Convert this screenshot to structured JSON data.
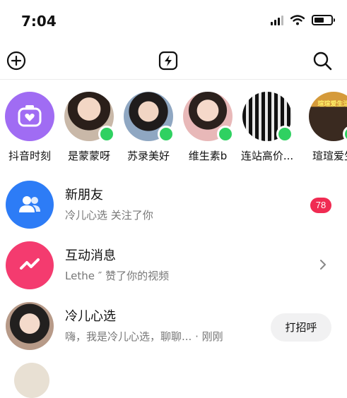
{
  "status_bar": {
    "time": "7:04"
  },
  "toolbar": {
    "add_icon": "plus-circle",
    "flash_icon": "lightning-square",
    "search_icon": "search"
  },
  "stories": [
    {
      "name": "抖音时刻",
      "kind": "moment",
      "color": "#a06cf3"
    },
    {
      "name": "是蒙蒙呀",
      "kind": "user",
      "online": true
    },
    {
      "name": "苏录美好",
      "kind": "user",
      "online": true
    },
    {
      "name": "维生素b",
      "kind": "user",
      "online": true
    },
    {
      "name": "连站高价...",
      "kind": "user",
      "online": true
    },
    {
      "name": "瑄瑄爱生",
      "kind": "user",
      "online": true,
      "avatar_text": "瑄瑄爱生活"
    }
  ],
  "rows": {
    "new_friends": {
      "title": "新朋友",
      "subtitle": "冷儿心选 关注了你",
      "badge": "78",
      "icon": "people-icon",
      "color": "#2d7cf6"
    },
    "interactions": {
      "title": "互动消息",
      "subtitle": "Lethe ″ 赞了你的视频",
      "icon": "bolt-wave-icon",
      "color": "#f43b6f"
    },
    "chat": {
      "title": "冷儿心选",
      "subtitle": "嗨，我是冷儿心选，聊聊... · 刚刚",
      "button": "打招呼"
    }
  },
  "colors": {
    "badge": "#f02b52",
    "online": "#2fd161",
    "blue": "#2d7cf6",
    "pink": "#f43b6f"
  }
}
